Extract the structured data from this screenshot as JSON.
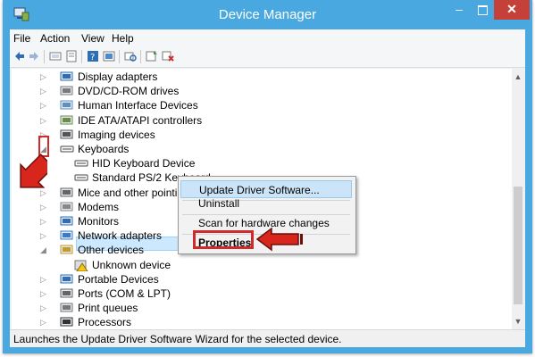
{
  "window": {
    "title": "Device Manager",
    "minimize": "–",
    "close": "✕"
  },
  "menu": {
    "items": [
      "File",
      "Action",
      "View",
      "Help"
    ]
  },
  "toolbar": {
    "icons": [
      "back-icon",
      "forward-icon",
      "computer-icon",
      "properties-icon",
      "help-icon",
      "update-icon",
      "scan-icon",
      "update-driver-icon",
      "uninstall-icon"
    ]
  },
  "tree": {
    "items": [
      {
        "label": "Display adapters",
        "expander": "▷",
        "icon": "display-icon"
      },
      {
        "label": "DVD/CD-ROM drives",
        "expander": "▷",
        "icon": "dvd-icon"
      },
      {
        "label": "Human Interface Devices",
        "expander": "▷",
        "icon": "hid-icon"
      },
      {
        "label": "IDE ATA/ATAPI controllers",
        "expander": "▷",
        "icon": "ide-icon"
      },
      {
        "label": "Imaging devices",
        "expander": "▷",
        "icon": "camera-icon"
      },
      {
        "label": "Keyboards",
        "expander": "◢",
        "icon": "keyboard-icon"
      },
      {
        "label": "HID Keyboard Device",
        "expander": "",
        "icon": "keyboard-icon"
      },
      {
        "label": "Standard PS/2 Keyboard",
        "expander": "",
        "icon": "keyboard-icon"
      },
      {
        "label": "Mice and other pointing",
        "expander": "▷",
        "icon": "mouse-icon"
      },
      {
        "label": "Modems",
        "expander": "▷",
        "icon": "modem-icon"
      },
      {
        "label": "Monitors",
        "expander": "▷",
        "icon": "monitor-icon"
      },
      {
        "label": "Network adapters",
        "expander": "▷",
        "icon": "network-icon"
      },
      {
        "label": "Other devices",
        "expander": "◢",
        "icon": "other-devices-icon"
      },
      {
        "label": "Unknown device",
        "expander": "",
        "icon": "unknown-device-icon"
      },
      {
        "label": "Portable Devices",
        "expander": "▷",
        "icon": "portable-icon"
      },
      {
        "label": "Ports (COM & LPT)",
        "expander": "▷",
        "icon": "port-icon"
      },
      {
        "label": "Print queues",
        "expander": "▷",
        "icon": "printer-icon"
      },
      {
        "label": "Processors",
        "expander": "▷",
        "icon": "processor-icon"
      }
    ]
  },
  "context_menu": {
    "items": [
      "Update Driver Software...",
      "Uninstall",
      "Scan for hardware changes",
      "Properties"
    ]
  },
  "status": {
    "text": "Launches the Update Driver Software Wizard for the selected device."
  },
  "colors": {
    "titlebar": "#4aa8e0",
    "close": "#c6403a",
    "highlight": "#d12a2a",
    "selection": "#cce8ff"
  }
}
